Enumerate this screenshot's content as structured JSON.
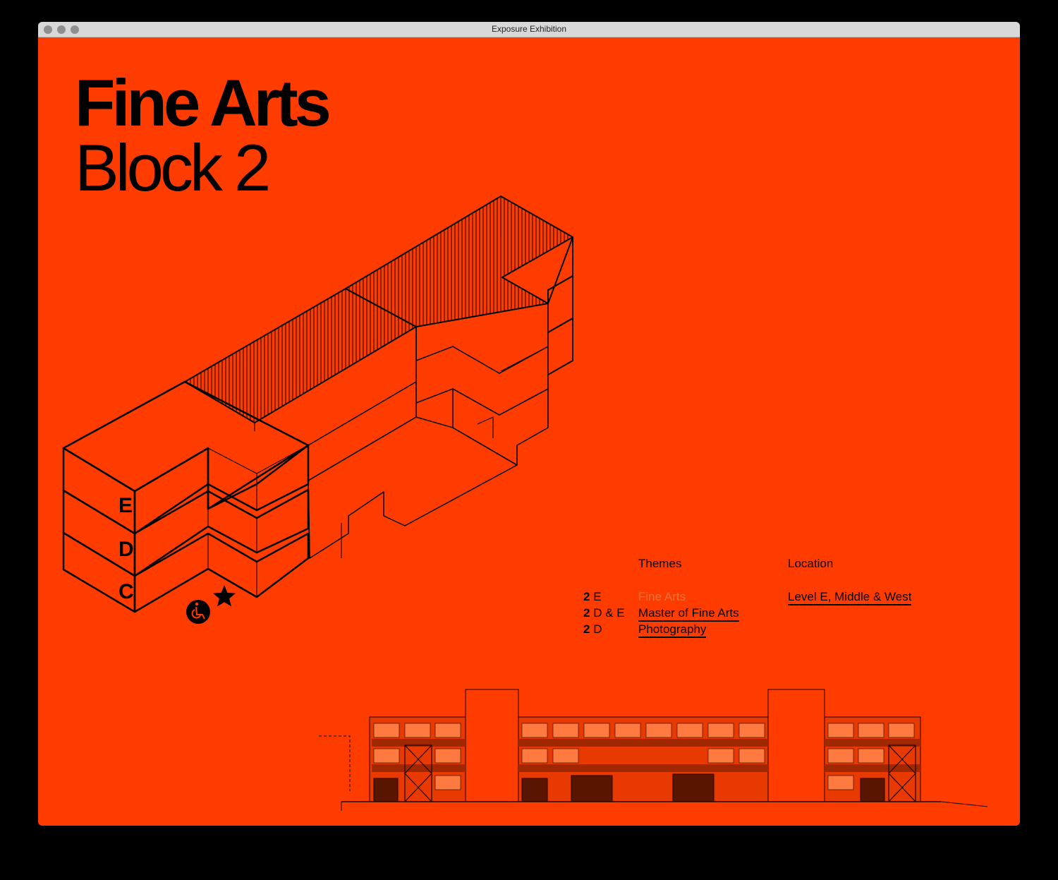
{
  "window": {
    "title": "Exposure Exhibition"
  },
  "heading": {
    "title": "Fine Arts",
    "subtitle": "Block 2"
  },
  "building": {
    "floor_labels": [
      "E",
      "D",
      "C"
    ]
  },
  "icons": {
    "accessibility": "wheelchair-icon",
    "entrance": "star-icon"
  },
  "columns": {
    "themes_header": "Themes",
    "location_header": "Location"
  },
  "rows": [
    {
      "level_num": "2",
      "level_letters": "E",
      "theme": "Fine Arts",
      "active": true
    },
    {
      "level_num": "2",
      "level_letters": "D & E",
      "theme": "Master of Fine Arts",
      "active": false
    },
    {
      "level_num": "2",
      "level_letters": "D",
      "theme": "Photography",
      "active": false
    }
  ],
  "location": {
    "text": "Level E, Middle & West"
  },
  "colors": {
    "background": "#ff3c00",
    "ink": "#000000",
    "muted": "#e8743c",
    "window_bg": "#000000"
  }
}
